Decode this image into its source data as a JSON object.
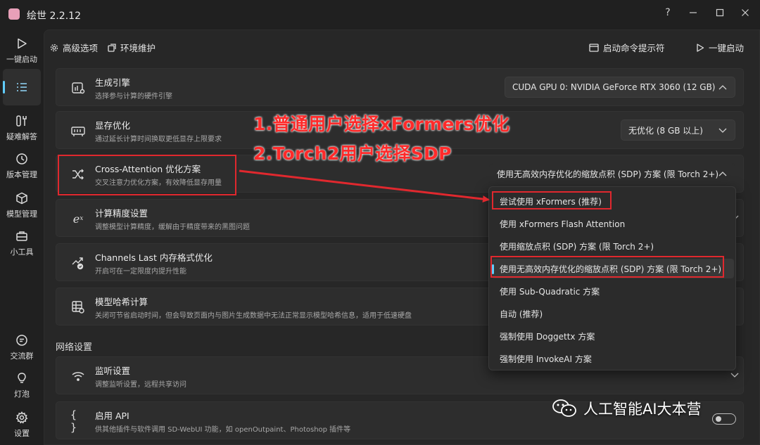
{
  "window": {
    "title": "绘世 2.2.12",
    "help": "?",
    "minimize": "—",
    "maximize": "☐",
    "close": "✕"
  },
  "sidebar": {
    "items": [
      {
        "label": "一键启动",
        "icon": "play-icon"
      },
      {
        "label": "",
        "icon": "list-icon"
      },
      {
        "label": "疑难解答",
        "icon": "wrench-icon"
      },
      {
        "label": "版本管理",
        "icon": "history-icon"
      },
      {
        "label": "模型管理",
        "icon": "cube-icon"
      },
      {
        "label": "小工具",
        "icon": "toolbox-icon"
      },
      {
        "label": "交流群",
        "icon": "chat-icon"
      },
      {
        "label": "灯泡",
        "icon": "bulb-icon"
      },
      {
        "label": "设置",
        "icon": "gear-icon"
      }
    ]
  },
  "topbar": {
    "tab_advanced": "高级选项",
    "tab_env": "环境维护",
    "cmd_prompt": "启动命令提示符",
    "one_click": "一键启动"
  },
  "cards": {
    "engine": {
      "title": "生成引擎",
      "subtitle": "选择参与计算的硬件引擎",
      "value": "CUDA GPU 0: NVIDIA GeForce RTX 3060 (12 GB)"
    },
    "vram": {
      "title": "显存优化",
      "subtitle": "通过延长计算时间换取更低显存上限要求",
      "value": "无优化 (8 GB 以上)"
    },
    "cross_attention": {
      "title": "Cross-Attention 优化方案",
      "subtitle": "交叉注意力优化方案，有效降低显存用量",
      "value": "使用无高效内存优化的缩放点积 (SDP) 方案 (限 Torch 2+)"
    },
    "precision": {
      "title": "计算精度设置",
      "subtitle": "调整模型计算精度，缓解由于精度带来的黑图问题"
    },
    "channels_last": {
      "title": "Channels Last 内存格式优化",
      "subtitle": "开启可在一定限度内提升性能"
    },
    "model_hash": {
      "title": "模型哈希计算",
      "subtitle": "关闭可节省启动时间，但会导致页面内与图片生成数据中无法正常显示模型哈希信息，适用于低速硬盘"
    },
    "network_section": "网络设置",
    "listen": {
      "title": "监听设置",
      "subtitle": "调整监听设置，远程共享访问"
    },
    "api": {
      "title": "启用 API",
      "subtitle": "供其他插件与软件调用 SD-WebUI 功能，如 openOutpaint、Photoshop 插件等"
    }
  },
  "dropdown": {
    "options": [
      "尝试使用 xFormers (推荐)",
      "使用 xFormers Flash Attention",
      "使用缩放点积 (SDP) 方案 (限 Torch 2+)",
      "使用无高效内存优化的缩放点积 (SDP) 方案 (限 Torch 2+)",
      "使用 Sub-Quadratic 方案",
      "自动 (推荐)",
      "强制使用 Doggettx 方案",
      "强制使用 InvokeAI 方案"
    ],
    "selected_index": 3
  },
  "annotations": {
    "line1": "1.普通用户选择xFormers优化",
    "line2": "2.Torch2用户选择SDP"
  },
  "watermark": "人工智能AI大本营",
  "colors": {
    "accent": "#60cdff",
    "annotation_red": "#e0282e",
    "background": "#202020",
    "card": "#2d2d2d"
  }
}
